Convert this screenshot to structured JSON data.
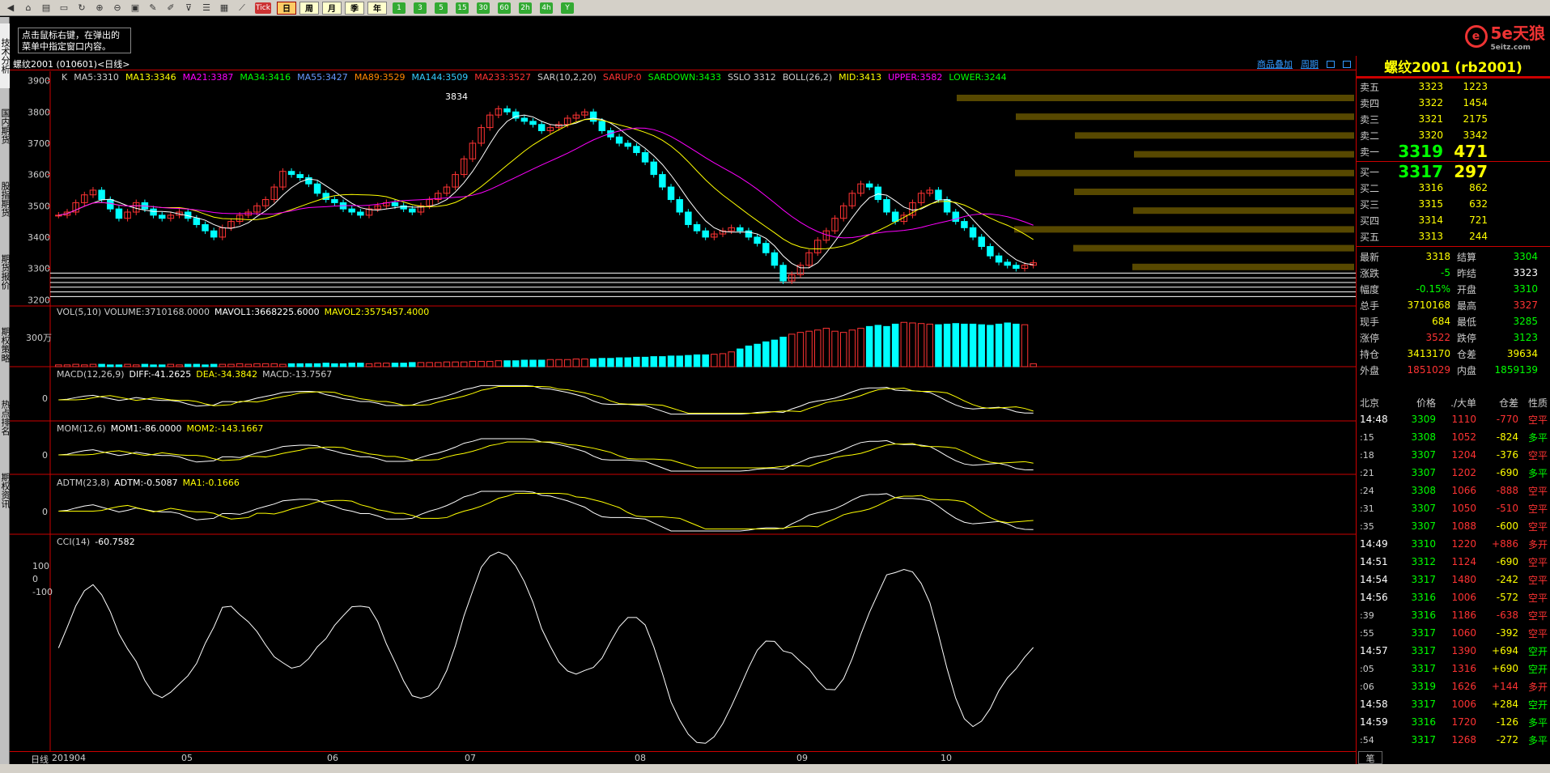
{
  "toolbar": {
    "icons": [
      "back-icon",
      "home-icon",
      "book-icon",
      "tv-icon",
      "refresh-icon",
      "zoom-in-icon",
      "zoom-out-icon",
      "window-icon",
      "pen-icon",
      "brush-icon",
      "filter-icon",
      "list-icon",
      "grid-icon",
      "line-chart-icon",
      "tick-icon"
    ],
    "tick_label": "Tick",
    "periods": [
      "日",
      "周",
      "月",
      "季",
      "年"
    ],
    "minutes": [
      "1",
      "3",
      "5",
      "15",
      "30",
      "60"
    ],
    "extras": [
      "2h",
      "4h",
      "Y"
    ]
  },
  "hint": "点击鼠标右键，在弹出的菜单中指定窗口内容。",
  "logo": {
    "text": "5e天狼",
    "sub": "5eitz.com"
  },
  "sidebar": [
    "技术分析",
    "国内期货",
    "股指期货",
    "期货报价",
    "期权策略",
    "热点排名",
    "期权资讯"
  ],
  "contract_line": "螺纹2001 (010601)<日线>",
  "header_links": {
    "add": "商品叠加",
    "period": "周期"
  },
  "indicators": [
    {
      "t": "K",
      "c": "#ccc"
    },
    {
      "t": "MA5:3310",
      "c": "#ccc"
    },
    {
      "t": "MA13:3346",
      "c": "#ff0"
    },
    {
      "t": "MA21:3387",
      "c": "#f0f"
    },
    {
      "t": "MA34:3416",
      "c": "#0f0"
    },
    {
      "t": "MA55:3427",
      "c": "#69f"
    },
    {
      "t": "MA89:3529",
      "c": "#f80"
    },
    {
      "t": "MA144:3509",
      "c": "#3cf"
    },
    {
      "t": "MA233:3527",
      "c": "#f33"
    },
    {
      "t": "SAR(10,2,20)",
      "c": "#ccc"
    },
    {
      "t": "SARUP:0",
      "c": "#f33"
    },
    {
      "t": "SARDOWN:3433",
      "c": "#0f0"
    },
    {
      "t": "SSLO 3312",
      "c": "#ccc"
    },
    {
      "t": "BOLL(26,2)",
      "c": "#ccc"
    },
    {
      "t": "MID:3413",
      "c": "#ff0"
    },
    {
      "t": "UPPER:3582",
      "c": "#f0f"
    },
    {
      "t": "LOWER:3244",
      "c": "#0f0"
    }
  ],
  "price_axis": [
    "3900",
    "3800",
    "3700",
    "3600",
    "3500",
    "3400",
    "3300",
    "3200"
  ],
  "peak_label": "3834",
  "vol": {
    "title": "VOL(5,10) VOLUME:3710168.0000",
    "mavol1": "MAVOL1:3668225.6000",
    "mavol2": "MAVOL2:3575457.4000",
    "axis": "300万"
  },
  "macd": {
    "title": "MACD(12,26,9)",
    "diff": "DIFF:-41.2625",
    "dea": "DEA:-34.3842",
    "macd": "MACD:-13.7567",
    "axis": "0"
  },
  "mom": {
    "title": "MOM(12,6)",
    "mom1": "MOM1:-86.0000",
    "mom2": "MOM2:-143.1667",
    "axis": "0"
  },
  "adtm": {
    "title": "ADTM(23,8)",
    "adtm": "ADTM:-0.5087",
    "ma1": "MA1:-0.1666",
    "axis": "0"
  },
  "cci": {
    "title": "CCI(14)",
    "val": "-60.7582",
    "axis": [
      "100",
      "0",
      "-100"
    ]
  },
  "xaxis": {
    "period": "日线",
    "labels": [
      "201904",
      "05",
      "06",
      "07",
      "08",
      "09",
      "10"
    ]
  },
  "right": {
    "title": "螺纹2001 (rb2001)",
    "asks": [
      {
        "l": "卖五",
        "p": "3323",
        "v": "1223"
      },
      {
        "l": "卖四",
        "p": "3322",
        "v": "1454"
      },
      {
        "l": "卖三",
        "p": "3321",
        "v": "2175"
      },
      {
        "l": "卖二",
        "p": "3320",
        "v": "3342"
      },
      {
        "l": "卖一",
        "p": "3319",
        "v": "471"
      }
    ],
    "bids": [
      {
        "l": "买一",
        "p": "3317",
        "v": "297"
      },
      {
        "l": "买二",
        "p": "3316",
        "v": "862"
      },
      {
        "l": "买三",
        "p": "3315",
        "v": "632"
      },
      {
        "l": "买四",
        "p": "3314",
        "v": "721"
      },
      {
        "l": "买五",
        "p": "3313",
        "v": "244"
      }
    ],
    "quote": [
      {
        "l1": "最新",
        "v1": "3318",
        "c1": "#ff0",
        "l2": "结算",
        "v2": "3304",
        "c2": "#0f0"
      },
      {
        "l1": "涨跌",
        "v1": "-5",
        "c1": "#0f0",
        "l2": "昨结",
        "v2": "3323",
        "c2": "#fff"
      },
      {
        "l1": "幅度",
        "v1": "-0.15%",
        "c1": "#0f0",
        "l2": "开盘",
        "v2": "3310",
        "c2": "#0f0"
      },
      {
        "l1": "总手",
        "v1": "3710168",
        "c1": "#ff0",
        "l2": "最高",
        "v2": "3327",
        "c2": "#f33"
      },
      {
        "l1": "现手",
        "v1": "684",
        "c1": "#ff0",
        "l2": "最低",
        "v2": "3285",
        "c2": "#0f0"
      },
      {
        "l1": "涨停",
        "v1": "3522",
        "c1": "#f33",
        "l2": "跌停",
        "v2": "3123",
        "c2": "#0f0"
      },
      {
        "l1": "持仓",
        "v1": "3413170",
        "c1": "#ff0",
        "l2": "仓差",
        "v2": "39634",
        "c2": "#ff0"
      },
      {
        "l1": "外盘",
        "v1": "1851029",
        "c1": "#f33",
        "l2": "内盘",
        "v2": "1859139",
        "c2": "#0f0"
      }
    ],
    "tick_header": [
      "北京",
      "价格",
      "./大单",
      "仓差",
      "性质"
    ],
    "ticks": [
      {
        "t": "14:48",
        "p": "3309",
        "v": "1110",
        "d": "-770",
        "ty": "空平",
        "dc": "#f33",
        "tc": "#f33"
      },
      {
        "t": ":15",
        "p": "3308",
        "v": "1052",
        "d": "-824",
        "ty": "多平",
        "dc": "#ff0",
        "tc": "#0f0"
      },
      {
        "t": ":18",
        "p": "3307",
        "v": "1204",
        "d": "-376",
        "ty": "空平",
        "dc": "#ff0",
        "tc": "#f33"
      },
      {
        "t": ":21",
        "p": "3307",
        "v": "1202",
        "d": "-690",
        "ty": "多平",
        "dc": "#ff0",
        "tc": "#0f0"
      },
      {
        "t": ":24",
        "p": "3308",
        "v": "1066",
        "d": "-888",
        "ty": "空平",
        "dc": "#f33",
        "tc": "#f33"
      },
      {
        "t": ":31",
        "p": "3307",
        "v": "1050",
        "d": "-510",
        "ty": "空平",
        "dc": "#f33",
        "tc": "#f33"
      },
      {
        "t": ":35",
        "p": "3307",
        "v": "1088",
        "d": "-600",
        "ty": "空平",
        "dc": "#ff0",
        "tc": "#f33"
      },
      {
        "t": "14:49",
        "p": "3310",
        "v": "1220",
        "d": "+886",
        "ty": "多开",
        "dc": "#f33",
        "tc": "#f33"
      },
      {
        "t": "14:51",
        "p": "3312",
        "v": "1124",
        "d": "-690",
        "ty": "空平",
        "dc": "#ff0",
        "tc": "#f33"
      },
      {
        "t": "14:54",
        "p": "3317",
        "v": "1480",
        "d": "-242",
        "ty": "空平",
        "dc": "#ff0",
        "tc": "#f33"
      },
      {
        "t": "14:56",
        "p": "3316",
        "v": "1006",
        "d": "-572",
        "ty": "空平",
        "dc": "#ff0",
        "tc": "#f33"
      },
      {
        "t": ":39",
        "p": "3316",
        "v": "1186",
        "d": "-638",
        "ty": "空平",
        "dc": "#f33",
        "tc": "#f33"
      },
      {
        "t": ":55",
        "p": "3317",
        "v": "1060",
        "d": "-392",
        "ty": "空平",
        "dc": "#ff0",
        "tc": "#f33"
      },
      {
        "t": "14:57",
        "p": "3317",
        "v": "1390",
        "d": "+694",
        "ty": "空开",
        "dc": "#ff0",
        "tc": "#0f0"
      },
      {
        "t": ":05",
        "p": "3317",
        "v": "1316",
        "d": "+690",
        "ty": "空开",
        "dc": "#ff0",
        "tc": "#0f0"
      },
      {
        "t": ":06",
        "p": "3319",
        "v": "1626",
        "d": "+144",
        "ty": "多开",
        "dc": "#f33",
        "tc": "#f33"
      },
      {
        "t": "14:58",
        "p": "3317",
        "v": "1006",
        "d": "+284",
        "ty": "空开",
        "dc": "#ff0",
        "tc": "#0f0"
      },
      {
        "t": "14:59",
        "p": "3316",
        "v": "1720",
        "d": "-126",
        "ty": "多平",
        "dc": "#ff0",
        "tc": "#0f0"
      },
      {
        "t": ":54",
        "p": "3317",
        "v": "1268",
        "d": "-272",
        "ty": "多平",
        "dc": "#ff0",
        "tc": "#0f0"
      }
    ],
    "bottom_tab": "笔"
  },
  "chart_data": {
    "type": "candlestick",
    "title": "螺纹2001 (010601)<日线>",
    "xlabel": "",
    "ylabel": "",
    "ylim": [
      3180,
      3930
    ],
    "x_ticks": [
      "201904",
      "05",
      "06",
      "07",
      "08",
      "09",
      "10"
    ],
    "closes": [
      3470,
      3480,
      3510,
      3535,
      3550,
      3520,
      3490,
      3460,
      3480,
      3510,
      3490,
      3470,
      3460,
      3470,
      3480,
      3460,
      3440,
      3420,
      3400,
      3430,
      3450,
      3470,
      3480,
      3500,
      3520,
      3560,
      3610,
      3600,
      3590,
      3570,
      3540,
      3520,
      3510,
      3490,
      3480,
      3470,
      3490,
      3500,
      3510,
      3500,
      3490,
      3480,
      3500,
      3520,
      3540,
      3560,
      3600,
      3650,
      3700,
      3750,
      3790,
      3810,
      3800,
      3780,
      3770,
      3760,
      3740,
      3750,
      3760,
      3780,
      3790,
      3800,
      3770,
      3740,
      3720,
      3700,
      3690,
      3670,
      3640,
      3600,
      3560,
      3520,
      3480,
      3440,
      3420,
      3400,
      3410,
      3420,
      3430,
      3420,
      3400,
      3380,
      3350,
      3310,
      3260,
      3280,
      3310,
      3350,
      3390,
      3420,
      3460,
      3500,
      3540,
      3570,
      3560,
      3520,
      3480,
      3450,
      3470,
      3510,
      3540,
      3550,
      3520,
      3480,
      3450,
      3430,
      3400,
      3370,
      3340,
      3320,
      3310,
      3300,
      3310,
      3318
    ],
    "volume_scale_max": 5000000,
    "volume_ratio": [
      0.03,
      0.03,
      0.04,
      0.03,
      0.04,
      0.04,
      0.03,
      0.03,
      0.04,
      0.03,
      0.04,
      0.03,
      0.03,
      0.04,
      0.03,
      0.04,
      0.04,
      0.03,
      0.04,
      0.04,
      0.04,
      0.05,
      0.04,
      0.05,
      0.05,
      0.05,
      0.04,
      0.05,
      0.05,
      0.05,
      0.05,
      0.06,
      0.05,
      0.05,
      0.06,
      0.06,
      0.05,
      0.06,
      0.06,
      0.06,
      0.06,
      0.07,
      0.07,
      0.07,
      0.07,
      0.08,
      0.08,
      0.08,
      0.09,
      0.09,
      0.09,
      0.1,
      0.1,
      0.1,
      0.11,
      0.11,
      0.11,
      0.12,
      0.12,
      0.12,
      0.13,
      0.13,
      0.13,
      0.14,
      0.14,
      0.15,
      0.15,
      0.16,
      0.16,
      0.17,
      0.17,
      0.18,
      0.18,
      0.19,
      0.2,
      0.2,
      0.21,
      0.22,
      0.25,
      0.3,
      0.35,
      0.38,
      0.42,
      0.45,
      0.5,
      0.55,
      0.58,
      0.6,
      0.62,
      0.65,
      0.6,
      0.58,
      0.62,
      0.65,
      0.68,
      0.7,
      0.68,
      0.72,
      0.75,
      0.74,
      0.73,
      0.72,
      0.71,
      0.72,
      0.73,
      0.72,
      0.72,
      0.71,
      0.7,
      0.72,
      0.74,
      0.72,
      0.71
    ]
  }
}
